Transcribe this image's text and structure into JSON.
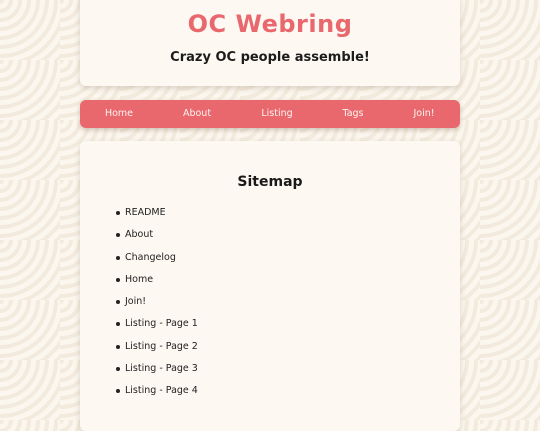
{
  "header": {
    "title": "OC Webring",
    "tagline": "Crazy OC people assemble!"
  },
  "nav": {
    "items": [
      {
        "label": "Home"
      },
      {
        "label": "About"
      },
      {
        "label": "Listing"
      },
      {
        "label": "Tags"
      },
      {
        "label": "Join!"
      }
    ]
  },
  "content": {
    "title": "Sitemap",
    "items": [
      {
        "label": "README"
      },
      {
        "label": "About"
      },
      {
        "label": "Changelog"
      },
      {
        "label": "Home"
      },
      {
        "label": "Join!"
      },
      {
        "label": "Listing - Page 1"
      },
      {
        "label": "Listing - Page 2"
      },
      {
        "label": "Listing - Page 3"
      },
      {
        "label": "Listing - Page 4"
      }
    ]
  },
  "colors": {
    "accent": "#e8686e",
    "panel": "#fdf8f2",
    "background": "#fbf6ee"
  }
}
